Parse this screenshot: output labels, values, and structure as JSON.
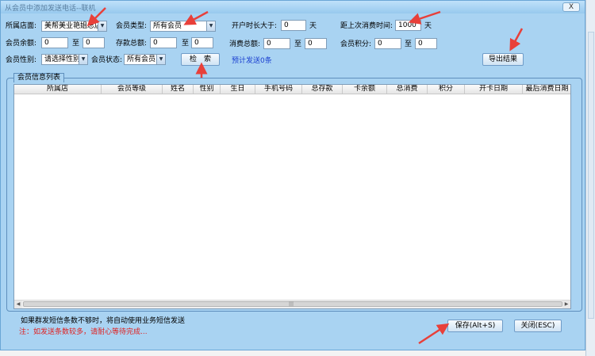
{
  "window": {
    "title": "从会员中添加发送电话--联机",
    "close_label": "X"
  },
  "filters": {
    "store_label": "所属店面:",
    "store_value": "美帮美业艳姐总店",
    "member_type_label": "会员类型:",
    "member_type_value": "所有会员",
    "open_duration_label": "开户时长大于:",
    "open_duration_value": "0",
    "open_duration_unit": "天",
    "last_consume_label": "距上次消费时间:",
    "last_consume_value": "1000",
    "last_consume_unit": "天",
    "balance_label": "会员余额:",
    "balance_from": "0",
    "balance_to_label": "至",
    "balance_to": "0",
    "deposit_label": "存款总额:",
    "deposit_from": "0",
    "deposit_to_label": "至",
    "deposit_to": "0",
    "consume_total_label": "消费总额:",
    "consume_total_from": "0",
    "consume_total_to_label": "至",
    "consume_total_to": "0",
    "points_label": "会员积分:",
    "points_from": "0",
    "points_to_label": "至",
    "points_to": "0",
    "gender_label": "会员性别:",
    "gender_value": "请选择性别",
    "status_label": "会员状态:",
    "status_value": "所有会员",
    "search_button": "检　索",
    "estimate_text": "预计发送0条",
    "export_button": "导出结果"
  },
  "member_list": {
    "group_title": "会员信息列表",
    "columns": [
      "所属店",
      "会员等级",
      "姓名",
      "性别",
      "生日",
      "手机号码",
      "总存款",
      "卡余额",
      "总消费",
      "积分",
      "开卡日期",
      "最后消费日期"
    ]
  },
  "footer": {
    "info_text": "如果群发短信条数不够时，将自动使用业务短信发送",
    "warning_text": "注：如发送条数较多，请耐心等待完成...",
    "save_button": "保存(Alt+S)",
    "close_button": "关闭(ESC)"
  },
  "colors": {
    "window_bg": "#a9d3f2",
    "estimate_text": "#1a3fd0",
    "warning_text": "#e02020",
    "annotation_arrow": "#e8403a"
  }
}
